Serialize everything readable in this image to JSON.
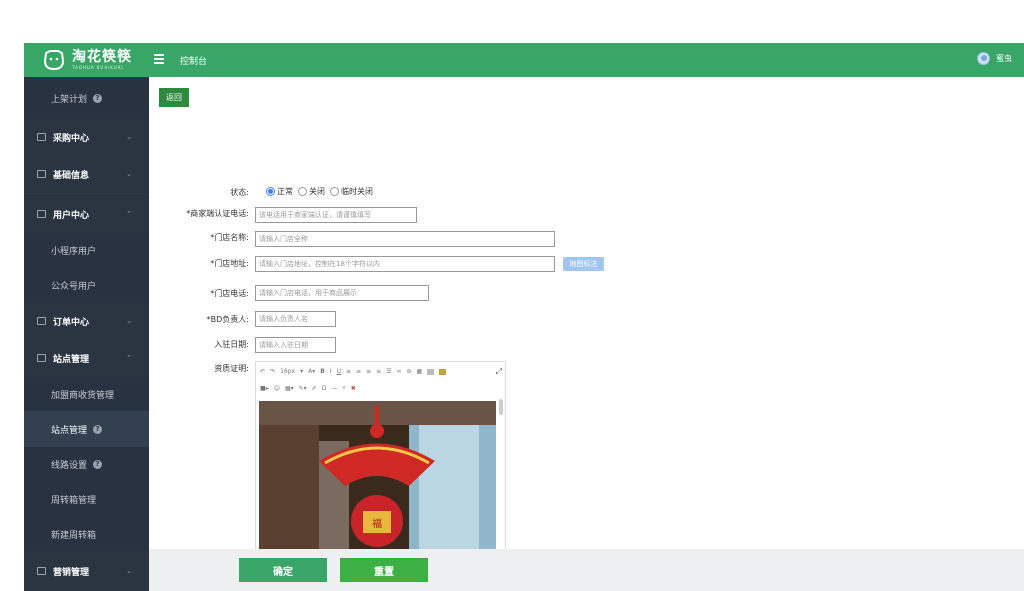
{
  "header": {
    "logo_text": "淘花筷筷",
    "logo_subtext": "TAOHUA KUAIKUAI",
    "title": "控制台",
    "user": "蜜虫"
  },
  "sidebar": [
    {
      "label": "上架计划",
      "type": "sub",
      "help": true
    },
    {
      "label": "采购中心",
      "type": "group",
      "chevron": "down"
    },
    {
      "label": "基础信息",
      "type": "group",
      "chevron": "down"
    },
    {
      "label": "用户中心",
      "type": "group",
      "chevron": "up"
    },
    {
      "label": "小程序用户",
      "type": "sub"
    },
    {
      "label": "公众号用户",
      "type": "sub"
    },
    {
      "label": "订单中心",
      "type": "group",
      "chevron": "down"
    },
    {
      "label": "站点管理",
      "type": "group",
      "chevron": "up"
    },
    {
      "label": "加盟商收货管理",
      "type": "sub"
    },
    {
      "label": "站点管理",
      "type": "sub",
      "help": true,
      "active": true
    },
    {
      "label": "线路设置",
      "type": "sub",
      "help": true
    },
    {
      "label": "周转箱管理",
      "type": "sub"
    },
    {
      "label": "新建周转箱",
      "type": "sub"
    },
    {
      "label": "营销管理",
      "type": "group",
      "chevron": "down"
    }
  ],
  "form": {
    "back": "返回",
    "status_label": "状态:",
    "status_options": [
      "正常",
      "关闭",
      "临时关闭"
    ],
    "status_selected": "正常",
    "phone_label": "*商家端认证电话:",
    "phone_placeholder": "该电话用于商家端认证，请谨慎填写",
    "name_label": "*门店名称:",
    "name_placeholder": "请输入门店全称",
    "address_label": "*门店地址:",
    "address_placeholder": "请输入门店地址，控制在18个字符以内",
    "map_button": "地图标注",
    "store_phone_label": "*门店电话:",
    "store_phone_placeholder": "请输入门店电话，用于商品展示",
    "bd_label": "*BD负责人:",
    "bd_placeholder": "请输入负责人名",
    "date_label": "入驻日期:",
    "date_placeholder": "请输入入驻日期",
    "cert_label": "资质证明:"
  },
  "editor": {
    "font_size": "16px",
    "word_count": "字数统计",
    "image_caption": "福"
  },
  "footer": {
    "confirm": "确定",
    "reset": "重置"
  },
  "colors": {
    "primary": "#38a667",
    "sidebar": "#2f3a47",
    "back": "#2e8b3e",
    "map": "#9fc6ef"
  }
}
